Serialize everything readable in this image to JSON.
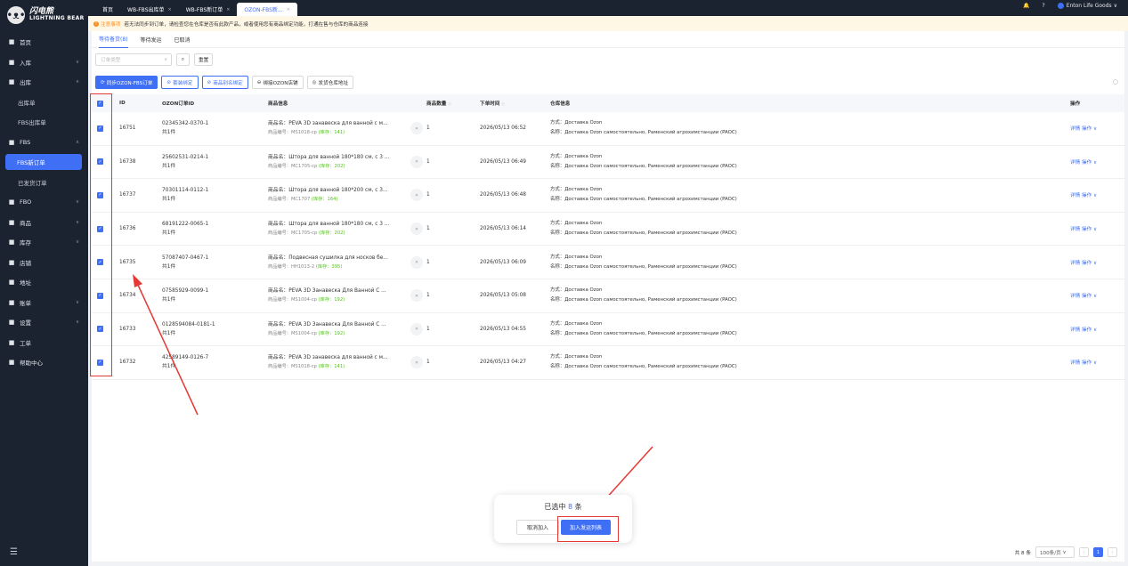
{
  "app": {
    "name_cn": "闪电熊",
    "name_en": "LIGHTNING BEAR"
  },
  "sidebar": {
    "items": [
      {
        "key": "home",
        "label": "首页",
        "icon": "home-icon"
      },
      {
        "key": "inbound",
        "label": "入库",
        "icon": "inbound-icon",
        "chevron": "∨"
      },
      {
        "key": "outbound",
        "label": "出库",
        "icon": "outbound-icon",
        "chevron": "∧"
      },
      {
        "key": "outbound-order",
        "label": "出库单",
        "sub": true
      },
      {
        "key": "fbs-outbound",
        "label": "FBS出库单",
        "sub": true
      },
      {
        "key": "fbs",
        "label": "FBS",
        "icon": "fbs-icon",
        "chevron": "∧"
      },
      {
        "key": "fbs-new",
        "label": "FBS新订单",
        "sub": true,
        "active": true
      },
      {
        "key": "shipped",
        "label": "已发货订单",
        "sub": true
      },
      {
        "key": "fbo",
        "label": "FBO",
        "icon": "fbo-icon",
        "chevron": "∨"
      },
      {
        "key": "product",
        "label": "商品",
        "icon": "product-icon",
        "chevron": "∨"
      },
      {
        "key": "stock",
        "label": "库存",
        "icon": "stock-icon",
        "chevron": "∨"
      },
      {
        "key": "shop",
        "label": "店铺",
        "icon": "shop-icon"
      },
      {
        "key": "address",
        "label": "地址",
        "icon": "address-icon"
      },
      {
        "key": "bill",
        "label": "账单",
        "icon": "bill-icon",
        "chevron": "∨"
      },
      {
        "key": "settings",
        "label": "设置",
        "icon": "settings-icon",
        "chevron": "∨"
      },
      {
        "key": "ticket",
        "label": "工单",
        "icon": "ticket-icon"
      },
      {
        "key": "help",
        "label": "帮助中心",
        "icon": "help-icon"
      }
    ]
  },
  "tabs": [
    {
      "label": "首页"
    },
    {
      "label": "WB-FBS出库单"
    },
    {
      "label": "WB-FBS新订单"
    },
    {
      "label": "OZON-FBS新...",
      "active": true
    }
  ],
  "topbar": {
    "shop": "Enton Life Goods"
  },
  "notice": {
    "label": "注意事项",
    "text": "若无法同步到订单，请检查您在仓库是否有此款产品，或者使用您有商品绑定功能，打通在售与仓库的商品连接"
  },
  "subtabs": [
    {
      "label": "等待备货(8)",
      "active": true
    },
    {
      "label": "等待发运"
    },
    {
      "label": "已取消"
    }
  ],
  "filters": {
    "order_type_placeholder": "订单类型",
    "reset": "重置"
  },
  "actions": {
    "sync": "同步OZON-FBS订单",
    "bundle_bind": "套装绑定",
    "rename_bind": "商品别名绑定",
    "bind_store": "绑接OZON店铺",
    "warehouse_address": "发货仓库地址"
  },
  "table": {
    "headers": {
      "id": "ID",
      "ozon_id": "OZON订单ID",
      "info": "商品信息",
      "qty": "商品数量",
      "time": "下单时间",
      "warehouse": "仓库信息",
      "op": "操作"
    },
    "name_prefix": "商品名：",
    "code_prefix": "商品编号：",
    "stock_prefix": "库存：",
    "method_prefix": "方式：",
    "wname_prefix": "名称：",
    "rows": [
      {
        "id": "16751",
        "ozon_id": "02345342-0370-1",
        "count": "共1件",
        "name": "PEVA 3D занавеска для ванной с м...",
        "code": "MS1018-cp",
        "stock": "141",
        "qty": "1",
        "time": "2026/05/13 06:52",
        "method": "Доставка Ozon",
        "wname": "Доставка Ozon самостоятельно, Раменский агрохимстанции (PAOC)",
        "detail": "详情",
        "op": "操作"
      },
      {
        "id": "16738",
        "ozon_id": "25602531-0214-1",
        "count": "共1件",
        "name": "Штора для ванной 180*180 см, с 3 ...",
        "code": "MC1705-cp",
        "stock": "202",
        "qty": "1",
        "time": "2026/05/13 06:49",
        "method": "Доставка Ozon",
        "wname": "Доставка Ozon самостоятельно, Раменский агрохимстанции (PAOC)",
        "detail": "详情",
        "op": "操作"
      },
      {
        "id": "16737",
        "ozon_id": "70301114-0112-1",
        "count": "共1件",
        "name": "Штора для ванной 180*200 см, с 3...",
        "code": "MC1707",
        "stock": "164",
        "qty": "1",
        "time": "2026/05/13 06:48",
        "method": "Доставка Ozon",
        "wname": "Доставка Ozon самостоятельно, Раменский агрохимстанции (PAOC)",
        "detail": "详情",
        "op": "操作"
      },
      {
        "id": "16736",
        "ozon_id": "68191222-0065-1",
        "count": "共1件",
        "name": "Штора для ванной 180*180 см, с 3 ...",
        "code": "MC1705-cp",
        "stock": "202",
        "qty": "1",
        "time": "2026/05/13 06:14",
        "method": "Доставка Ozon",
        "wname": "Доставка Ozon самостоятельно, Раменский агрохимстанции (PAOC)",
        "detail": "详情",
        "op": "操作"
      },
      {
        "id": "16735",
        "ozon_id": "57087407-0467-1",
        "count": "共1件",
        "name": "Подвесная сушилка для носков бе...",
        "code": "HH1013-2",
        "stock": "395",
        "qty": "1",
        "time": "2026/05/13 06:09",
        "method": "Доставка Ozon",
        "wname": "Доставка Ozon самостоятельно, Раменский агрохимстанции (PAOC)",
        "detail": "详情",
        "op": "操作"
      },
      {
        "id": "16734",
        "ozon_id": "07585929-0099-1",
        "count": "共1件",
        "name": "PEVA 3D Занавеска Для Ванной С ...",
        "code": "MS1004-cp",
        "stock": "192",
        "qty": "1",
        "time": "2026/05/13 05:08",
        "method": "Доставка Ozon",
        "wname": "Доставка Ozon самостоятельно, Раменский агрохимстанции (PAOC)",
        "detail": "详情",
        "op": "操作"
      },
      {
        "id": "16733",
        "ozon_id": "0128594084-0181-1",
        "count": "共1件",
        "name": "PEVA 3D Занавеска Для Ванной С ...",
        "code": "MS1004-cp",
        "stock": "192",
        "qty": "1",
        "time": "2026/05/13 04:55",
        "method": "Доставка Ozon",
        "wname": "Доставка Ozon самостоятельно, Раменский агрохимстанции (PAOC)",
        "detail": "详情",
        "op": "操作"
      },
      {
        "id": "16732",
        "ozon_id": "42589149-0126-7",
        "count": "共1件",
        "name": "PEVA 3D занавеска для ванной с м...",
        "code": "MS1018-cp",
        "stock": "141",
        "qty": "1",
        "time": "2026/05/13 04:27",
        "method": "Доставка Ozon",
        "wname": "Доставка Ozon самостоятельно, Раменский агрохимстанции (PAOC)",
        "detail": "详情",
        "op": "操作"
      }
    ]
  },
  "popup": {
    "prefix": "已选中",
    "count": "8",
    "suffix": "条",
    "cancel": "取消加入",
    "add": "加入发运列表"
  },
  "pager": {
    "total": "共 8 条",
    "page_size": "100条/页",
    "current": "1"
  },
  "colors": {
    "accent": "#3f6ff5",
    "sidebar": "#1c2330",
    "highlight": "#e53935",
    "stock": "#52c41a"
  }
}
